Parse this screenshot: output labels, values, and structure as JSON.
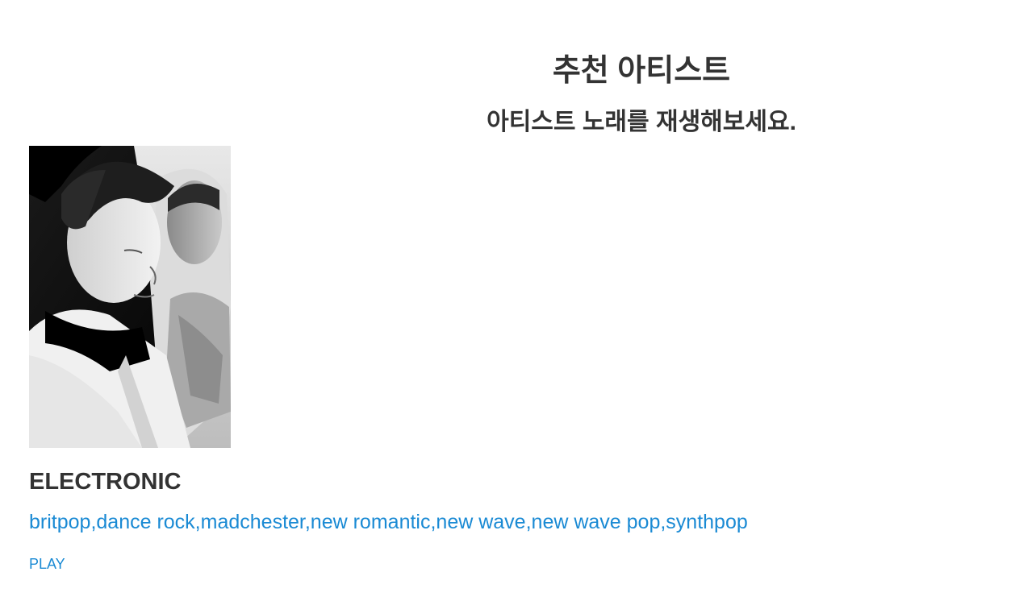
{
  "header": {
    "title": "추천 아티스트",
    "subtitle": "아티스트 노래를 재생해보세요."
  },
  "artists": [
    {
      "name": "ELECTRONIC",
      "genres": "britpop,dance rock,madchester,new romantic,new wave,new wave pop,synthpop",
      "play_label": "PLAY",
      "photo_icon": "artist-photo"
    }
  ],
  "colors": {
    "link": "#1a8ad4",
    "text": "#333333",
    "background": "#ffffff"
  }
}
